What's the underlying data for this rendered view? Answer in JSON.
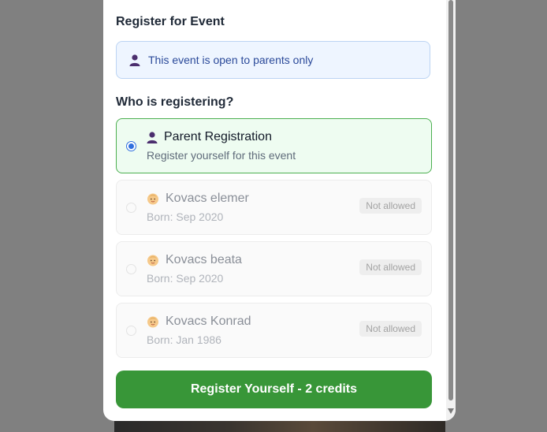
{
  "modal": {
    "title": "Register for Event",
    "info": {
      "icon": "person-icon",
      "text": "This event is open to parents only"
    },
    "subtitle": "Who is registering?",
    "options": [
      {
        "icon": "person-icon",
        "name": "Parent Registration",
        "sub": "Register yourself for this event",
        "selected": true,
        "badge": ""
      },
      {
        "icon": "baby-icon",
        "name": "Kovacs elemer",
        "sub": "Born: Sep 2020",
        "selected": false,
        "badge": "Not allowed"
      },
      {
        "icon": "baby-icon",
        "name": "Kovacs beata",
        "sub": "Born: Sep 2020",
        "selected": false,
        "badge": "Not allowed"
      },
      {
        "icon": "baby-icon",
        "name": "Kovacs Konrad",
        "sub": "Born: Jan 1986",
        "selected": false,
        "badge": "Not allowed"
      }
    ],
    "register_button": "Register Yourself - 2 credits"
  },
  "colors": {
    "accent": "#389638",
    "selected_border": "#4caf50",
    "radio": "#2f6fde",
    "info_text": "#2b4a9a"
  }
}
